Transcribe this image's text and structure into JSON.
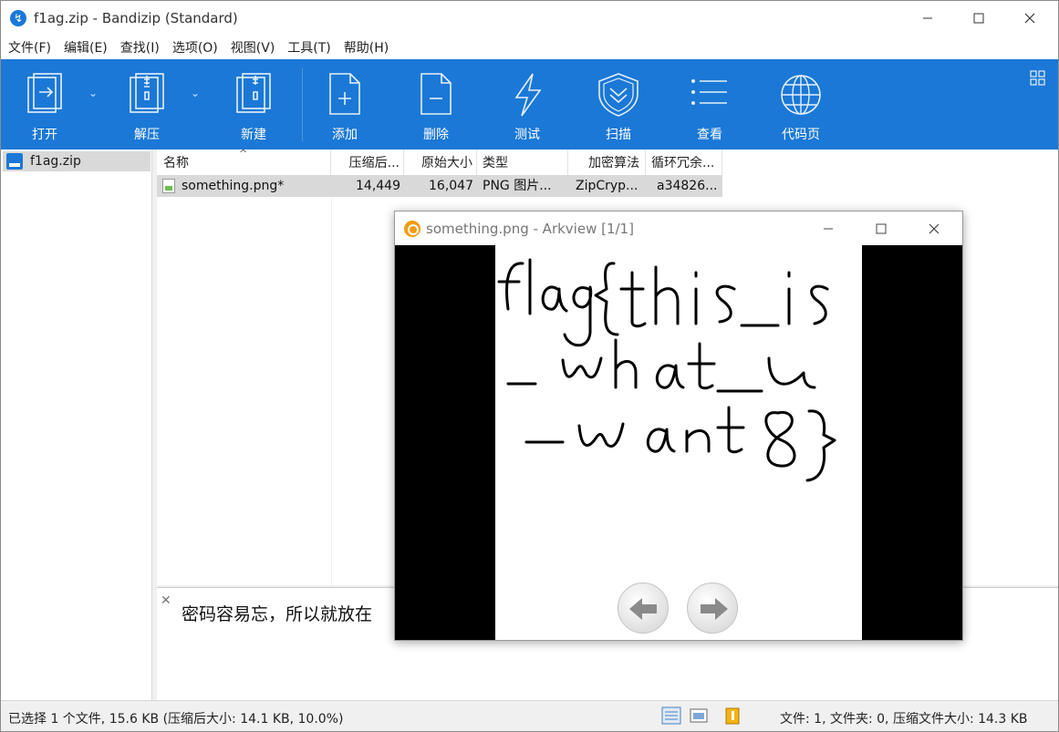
{
  "window": {
    "title": "f1ag.zip - Bandizip (Standard)"
  },
  "menu": [
    "文件(F)",
    "编辑(E)",
    "查找(I)",
    "选项(O)",
    "视图(V)",
    "工具(T)",
    "帮助(H)"
  ],
  "toolbar": {
    "open": "打开",
    "extract": "解压",
    "new": "新建",
    "add": "添加",
    "delete": "删除",
    "test": "测试",
    "scan": "扫描",
    "view": "查看",
    "codepage": "代码页"
  },
  "tree": {
    "root": "f1ag.zip"
  },
  "columns": {
    "name": "名称",
    "packed": "压缩后...",
    "original": "原始大小",
    "type": "类型",
    "encryption": "加密算法",
    "crc": "循环冗余..."
  },
  "files": [
    {
      "name": "something.png*",
      "packed": "14,449",
      "original": "16,047",
      "type": "PNG 图片...",
      "encryption": "ZipCryp...",
      "crc": "a34826..."
    }
  ],
  "comment": {
    "text": "密码容易忘，所以就放在"
  },
  "status": {
    "left": "已选择 1 个文件, 15.6 KB (压缩后大小: 14.1 KB, 10.0%)",
    "right": "文件: 1, 文件夹: 0, 压缩文件大小: 14.3 KB"
  },
  "viewer": {
    "title": "something.png - Arkview [1/1]",
    "image_text": "flag{this_is_what_u_want8}"
  },
  "colors": {
    "toolbar": "#1b78d6",
    "selection": "#d9d9d9"
  }
}
